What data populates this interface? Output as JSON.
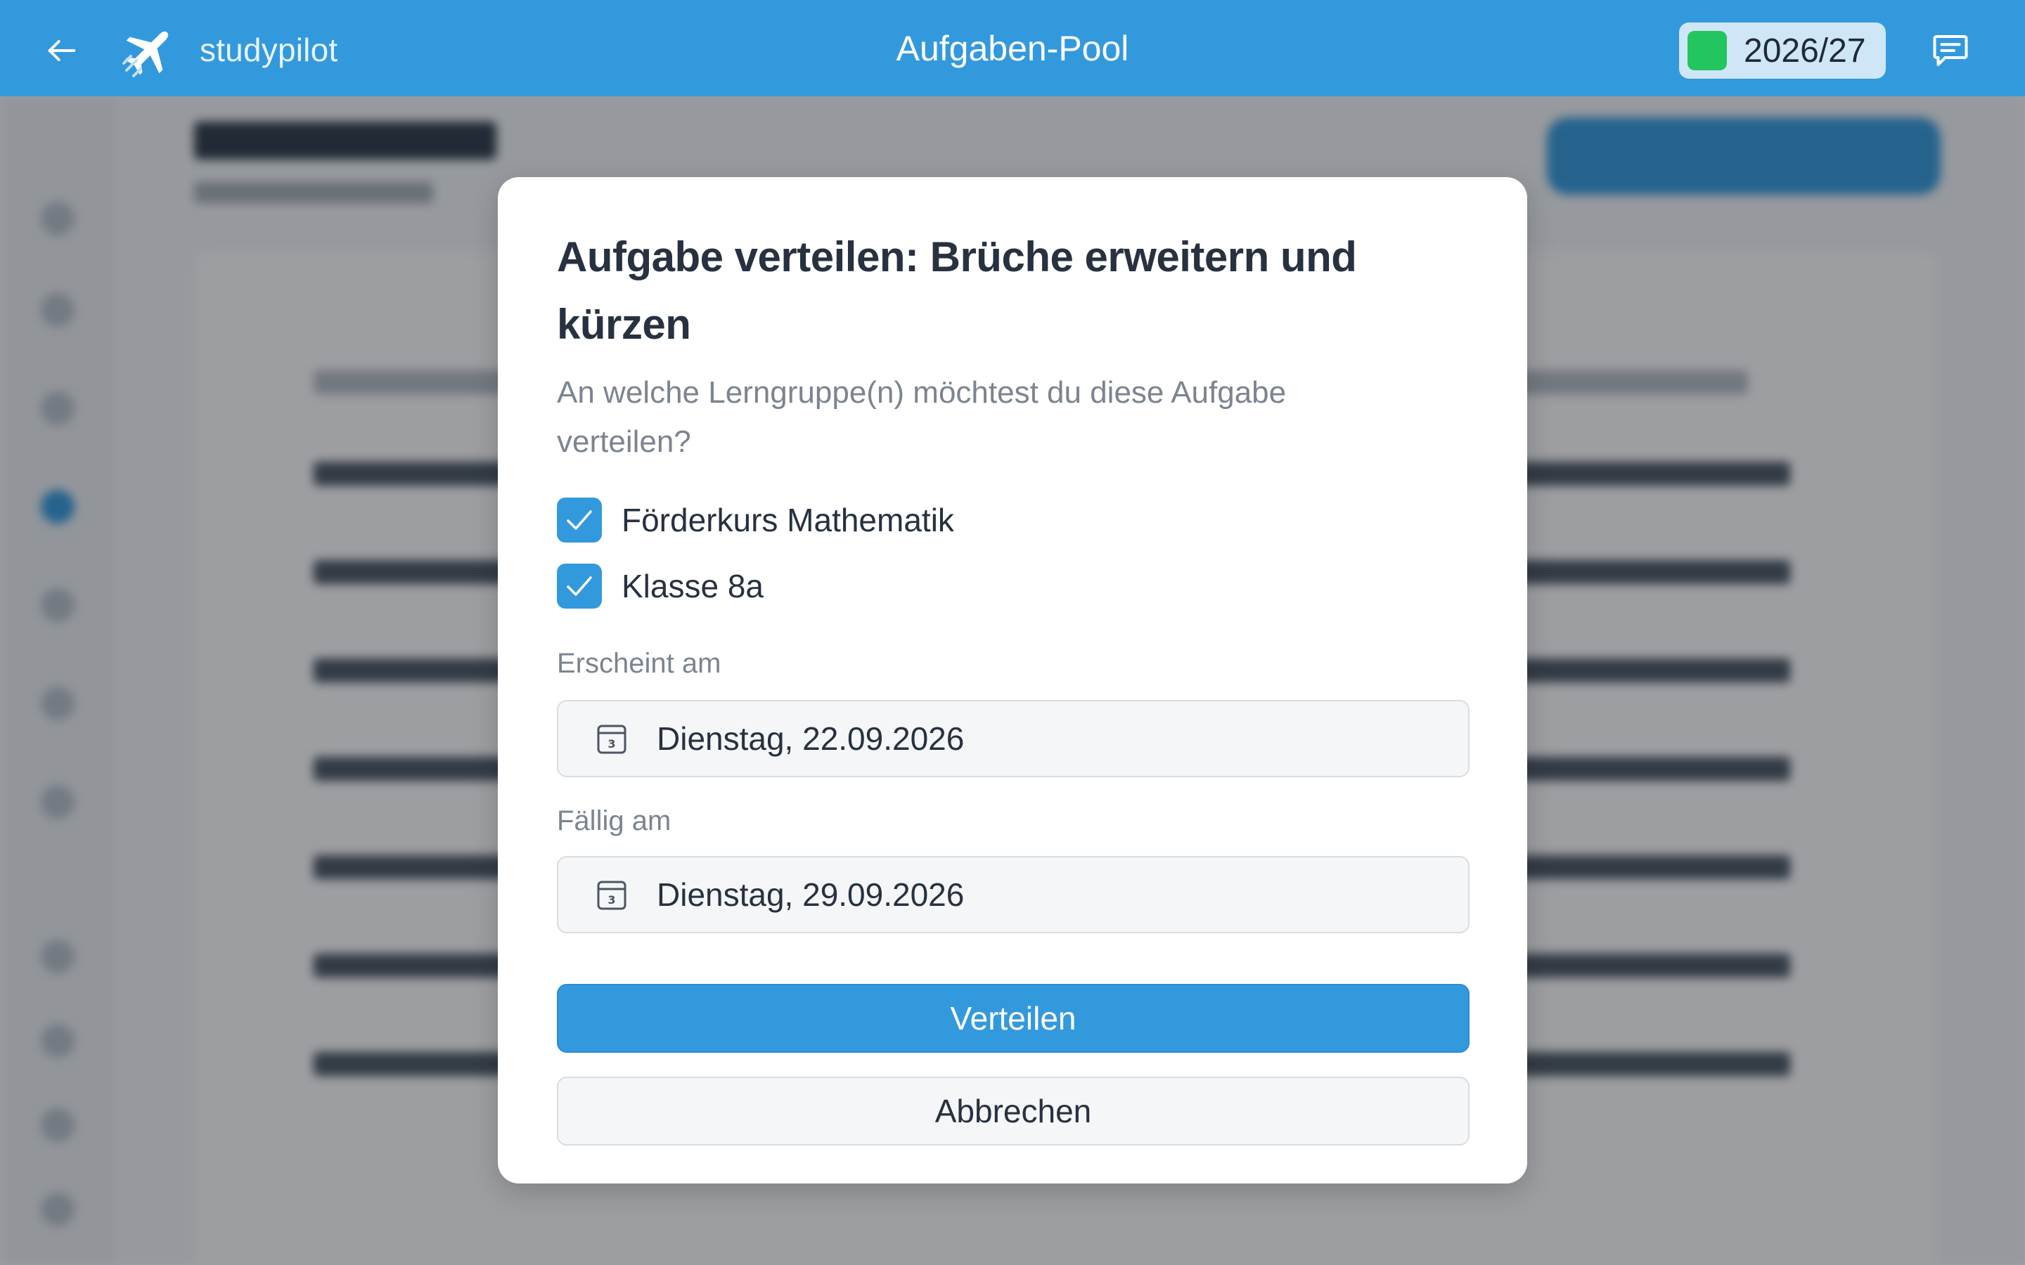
{
  "header": {
    "brand": "studypilot",
    "title": "Aufgaben-Pool",
    "school_year": "2026/27",
    "school_year_color": "#22c55e",
    "bar_color": "#3399dd",
    "back_icon": "arrow-left-icon",
    "logo_icon": "airplane-logo-icon",
    "chat_icon": "chat-icon"
  },
  "dialog": {
    "title": "Aufgabe verteilen: Brüche erweitern und kürzen",
    "description": "An welche Lerngruppe(n) möchtest du diese Aufgabe verteilen?",
    "groups": [
      {
        "label": "Förderkurs Mathematik",
        "checked": true
      },
      {
        "label": "Klasse 8a",
        "checked": true
      }
    ],
    "appears_label": "Erscheint am",
    "appears_value": "Dienstag, 22.09.2026",
    "due_label": "Fällig am",
    "due_value": "Dienstag, 29.09.2026",
    "calendar_icon": "calendar-icon",
    "calendar_icon_day": "3",
    "submit_label": "Verteilen",
    "cancel_label": "Abbrechen"
  }
}
